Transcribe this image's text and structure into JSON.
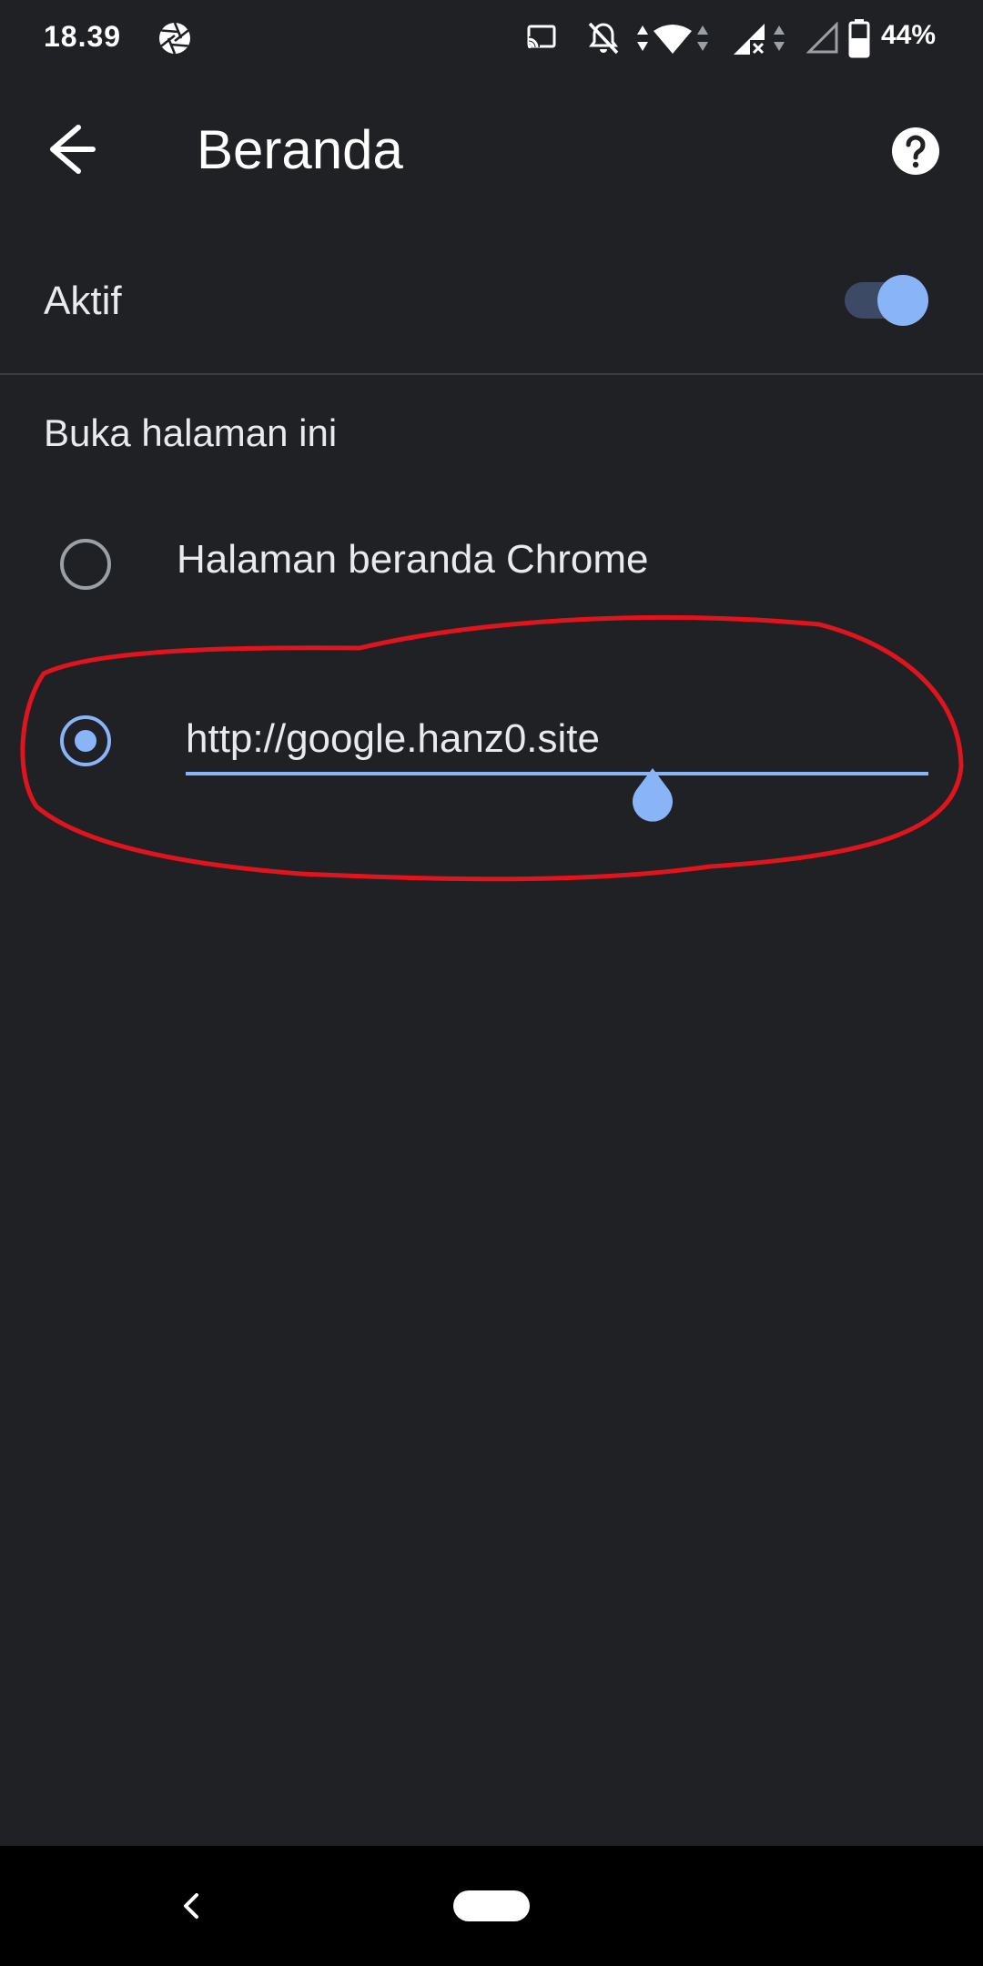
{
  "status_bar": {
    "time": "18.39",
    "battery": "44%",
    "icons": [
      "camera-aperture-icon",
      "cast-icon",
      "notifications-off-icon",
      "data-arrows-icon",
      "wifi-icon",
      "signal-icon",
      "signal-empty-icon",
      "battery-icon"
    ]
  },
  "app_bar": {
    "title": "Beranda",
    "back_icon": "arrow-back-icon",
    "help_icon": "help-icon"
  },
  "settings": {
    "active_label": "Aktif",
    "active_on": true,
    "section_label": "Buka halaman ini",
    "options": [
      {
        "label": "Halaman beranda Chrome",
        "selected": false
      },
      {
        "value": "http://google.hanz0.site",
        "selected": true
      }
    ]
  },
  "annotation": {
    "color": "#e0141c"
  },
  "colors": {
    "background": "#202125",
    "accent": "#8ab4f8",
    "text": "#e8eaed"
  }
}
